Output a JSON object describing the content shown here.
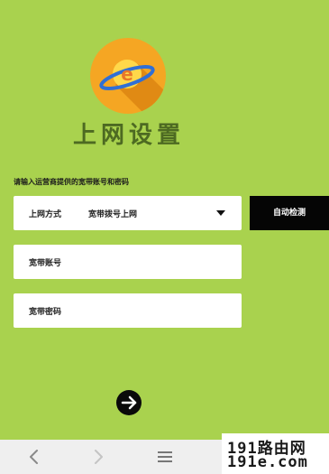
{
  "title": "上网设置",
  "prompt": "请输入运营商提供的宽带账号和密码",
  "connection": {
    "label": "上网方式",
    "value": "宽带拨号上网"
  },
  "detect_button": "自动检测",
  "fields": {
    "account_placeholder": "宽带账号",
    "password_placeholder": "宽带密码"
  },
  "logo_letter": "e",
  "icons": {
    "next": "arrow-right-icon",
    "back": "chevron-left-icon",
    "forward": "chevron-right-icon",
    "menu": "menu-icon"
  },
  "watermark": {
    "line1": "191路由网",
    "line2": "191e.com"
  },
  "colors": {
    "background": "#a9d24e",
    "title": "#4d6a22",
    "logo_orange": "#f5a623",
    "logo_ring": "#2f6fd6",
    "detect_button": "#050505"
  }
}
